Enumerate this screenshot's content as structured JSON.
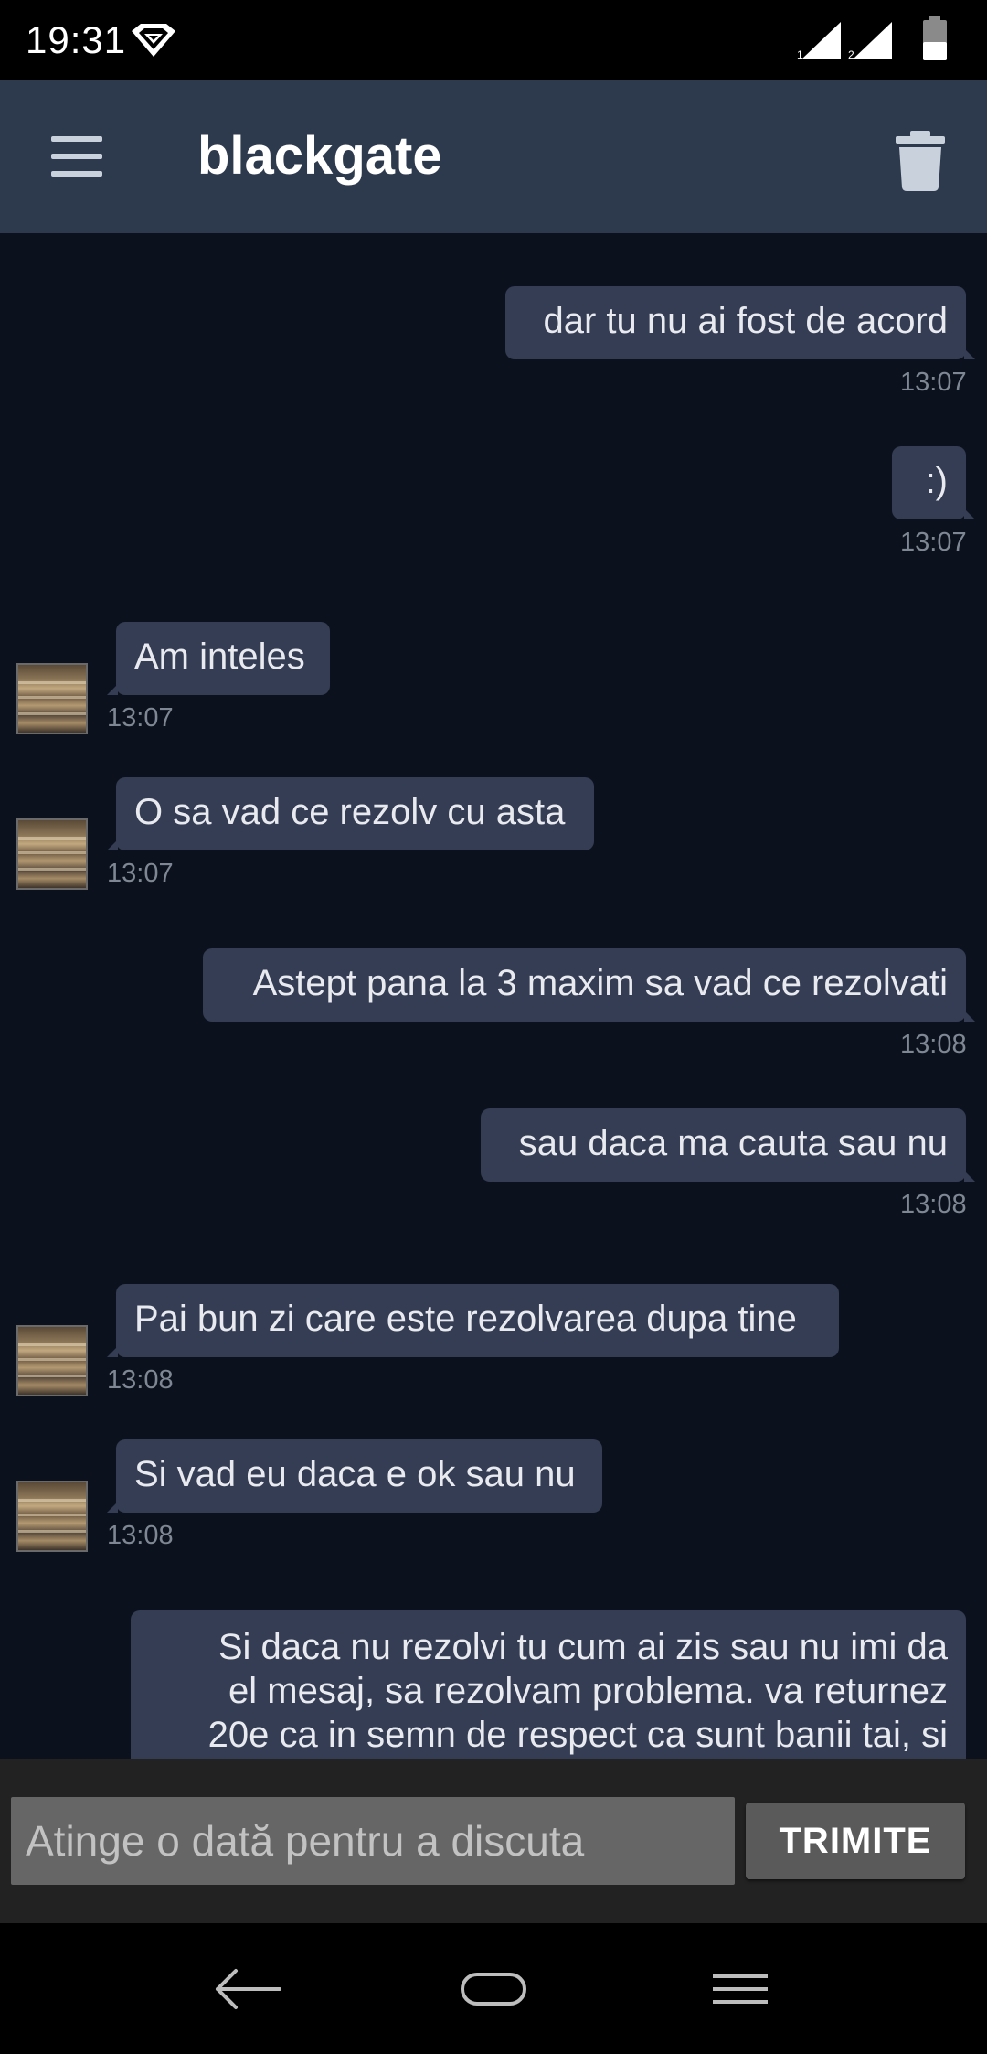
{
  "status_bar": {
    "time": "19:31",
    "icons": [
      "wifi-icon",
      "signal-sim1-icon",
      "signal-sim2-icon",
      "battery-icon"
    ],
    "sim1_label": "1",
    "sim2_label": "2"
  },
  "app_bar": {
    "title": "blackgate",
    "menu_icon": "hamburger-menu-icon",
    "delete_icon": "trash-icon",
    "background": "#2d3a4e"
  },
  "messages": [
    {
      "direction": "out",
      "text": "dar tu nu ai fost de acord",
      "time": "13:07"
    },
    {
      "direction": "out",
      "text": ":)",
      "time": "13:07"
    },
    {
      "direction": "in",
      "text": "Am inteles",
      "time": "13:07"
    },
    {
      "direction": "in",
      "text": "O sa vad ce rezolv cu asta",
      "time": "13:07"
    },
    {
      "direction": "out",
      "text": "Astept pana la 3 maxim sa vad ce rezolvati",
      "time": "13:08"
    },
    {
      "direction": "out",
      "text": "sau daca ma cauta sau nu",
      "time": "13:08"
    },
    {
      "direction": "in",
      "text": "Pai bun zi care este rezolvarea dupa tine",
      "time": "13:08"
    },
    {
      "direction": "in",
      "text": "Si vad eu daca e ok sau nu",
      "time": "13:08"
    },
    {
      "direction": "out",
      "lines": [
        "Si daca nu rezolvi tu cum ai zis sau nu imi da",
        "el mesaj, sa rezolvam problema. va returnez",
        "20e ca in semn de respect ca sunt banii tai, si"
      ]
    }
  ],
  "composer": {
    "placeholder": "Atinge o dată pentru a discuta",
    "send_label": "TRIMITE"
  },
  "nav_bar": {
    "icons": [
      "back-icon",
      "home-icon",
      "recents-icon"
    ]
  },
  "colors": {
    "chat_background": "#0c121d",
    "bubble": "#343d54",
    "timestamp": "#7f8794"
  }
}
